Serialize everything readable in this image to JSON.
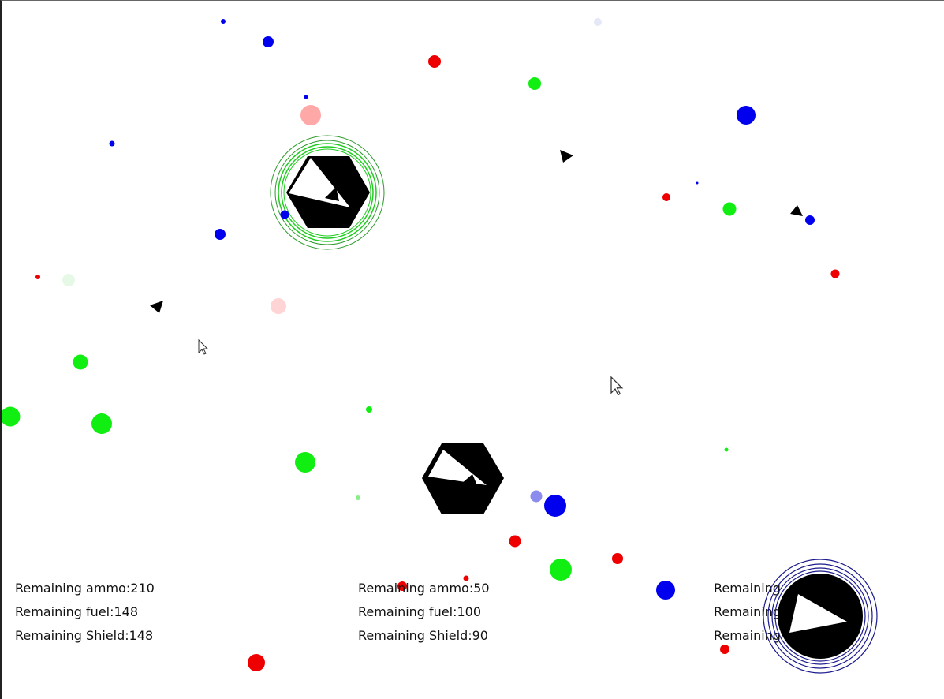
{
  "players": [
    {
      "id": "player-1",
      "shield_color": "#2a9a2a",
      "hud": {
        "ammo_label": "Remaining ammo:210",
        "fuel_label": "Remaining fuel:148",
        "shield_label": "Remaining Shield:148"
      }
    },
    {
      "id": "player-2",
      "shield_color": null,
      "hud": {
        "ammo_label": "Remaining ammo:50",
        "fuel_label": "Remaining fuel:100",
        "shield_label": "Remaining Shield:90"
      }
    },
    {
      "id": "player-3",
      "shield_color": "#1a1a8c",
      "hud": {
        "ammo_label": "Remaining",
        "fuel_label": "Remaining fuel:1",
        "shield_label": "Remaining"
      }
    }
  ],
  "colors": {
    "background": "#ffffff",
    "ship": "#000000",
    "red_orb": "#ff0000",
    "green_orb": "#00ee00",
    "blue_orb": "#0000ee"
  },
  "icons": [
    "ship-hexagon-icon",
    "shield-ring-icon",
    "projectile-arrow-icon",
    "mouse-cursor-icon",
    "energy-orb-icon"
  ]
}
